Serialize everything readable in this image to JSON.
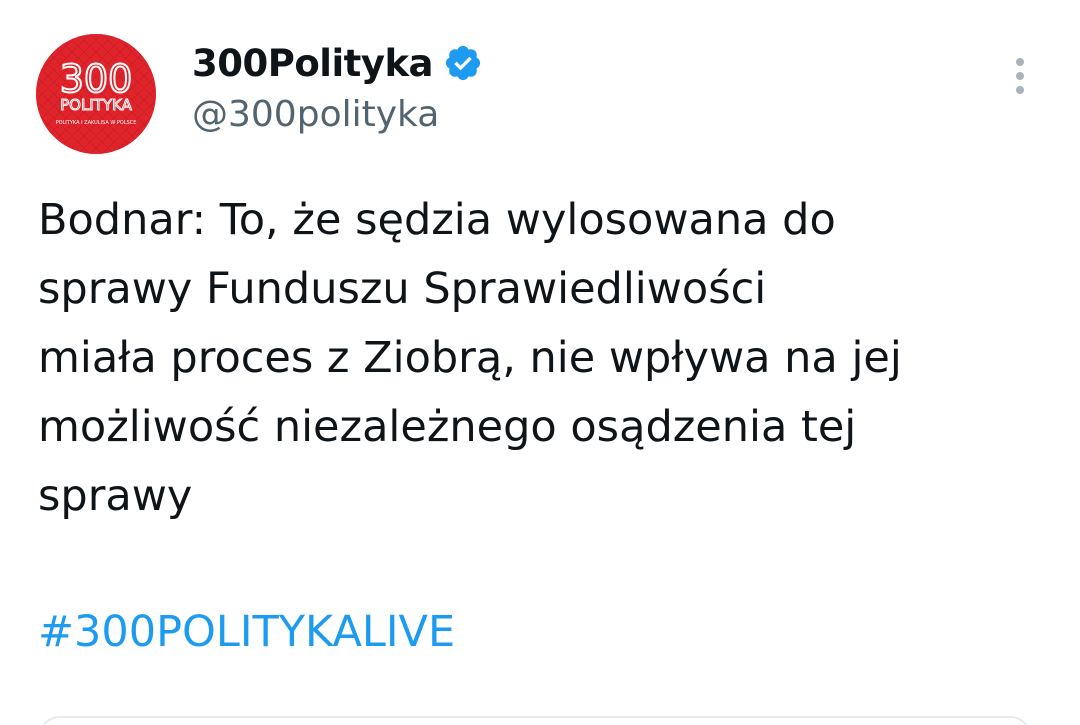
{
  "author": {
    "display_name": "300Polityka",
    "handle": "@300polityka",
    "verified": true,
    "avatar": {
      "text_main": "300",
      "text_sub": "POLITYKA",
      "text_tagline": "POLITYKA I ZAKULISA W POLSCE",
      "color": "#e0242b"
    }
  },
  "tweet": {
    "text": "Bodnar: To, że sędzia wylosowana do\nsprawy Funduszu Sprawiedliwości\nmiała proces z Ziobrą, nie wpływa na jej\nmożliwość niezależnego osądzenia tej\nsprawy",
    "hashtag": "#300POLITYKALIVE"
  },
  "icons": {
    "verified": "verified-badge-icon",
    "more": "more-vertical-icon"
  },
  "colors": {
    "text": "#0f1419",
    "secondary": "#536471",
    "link": "#1d9bf0",
    "verified": "#1d9bf0"
  }
}
